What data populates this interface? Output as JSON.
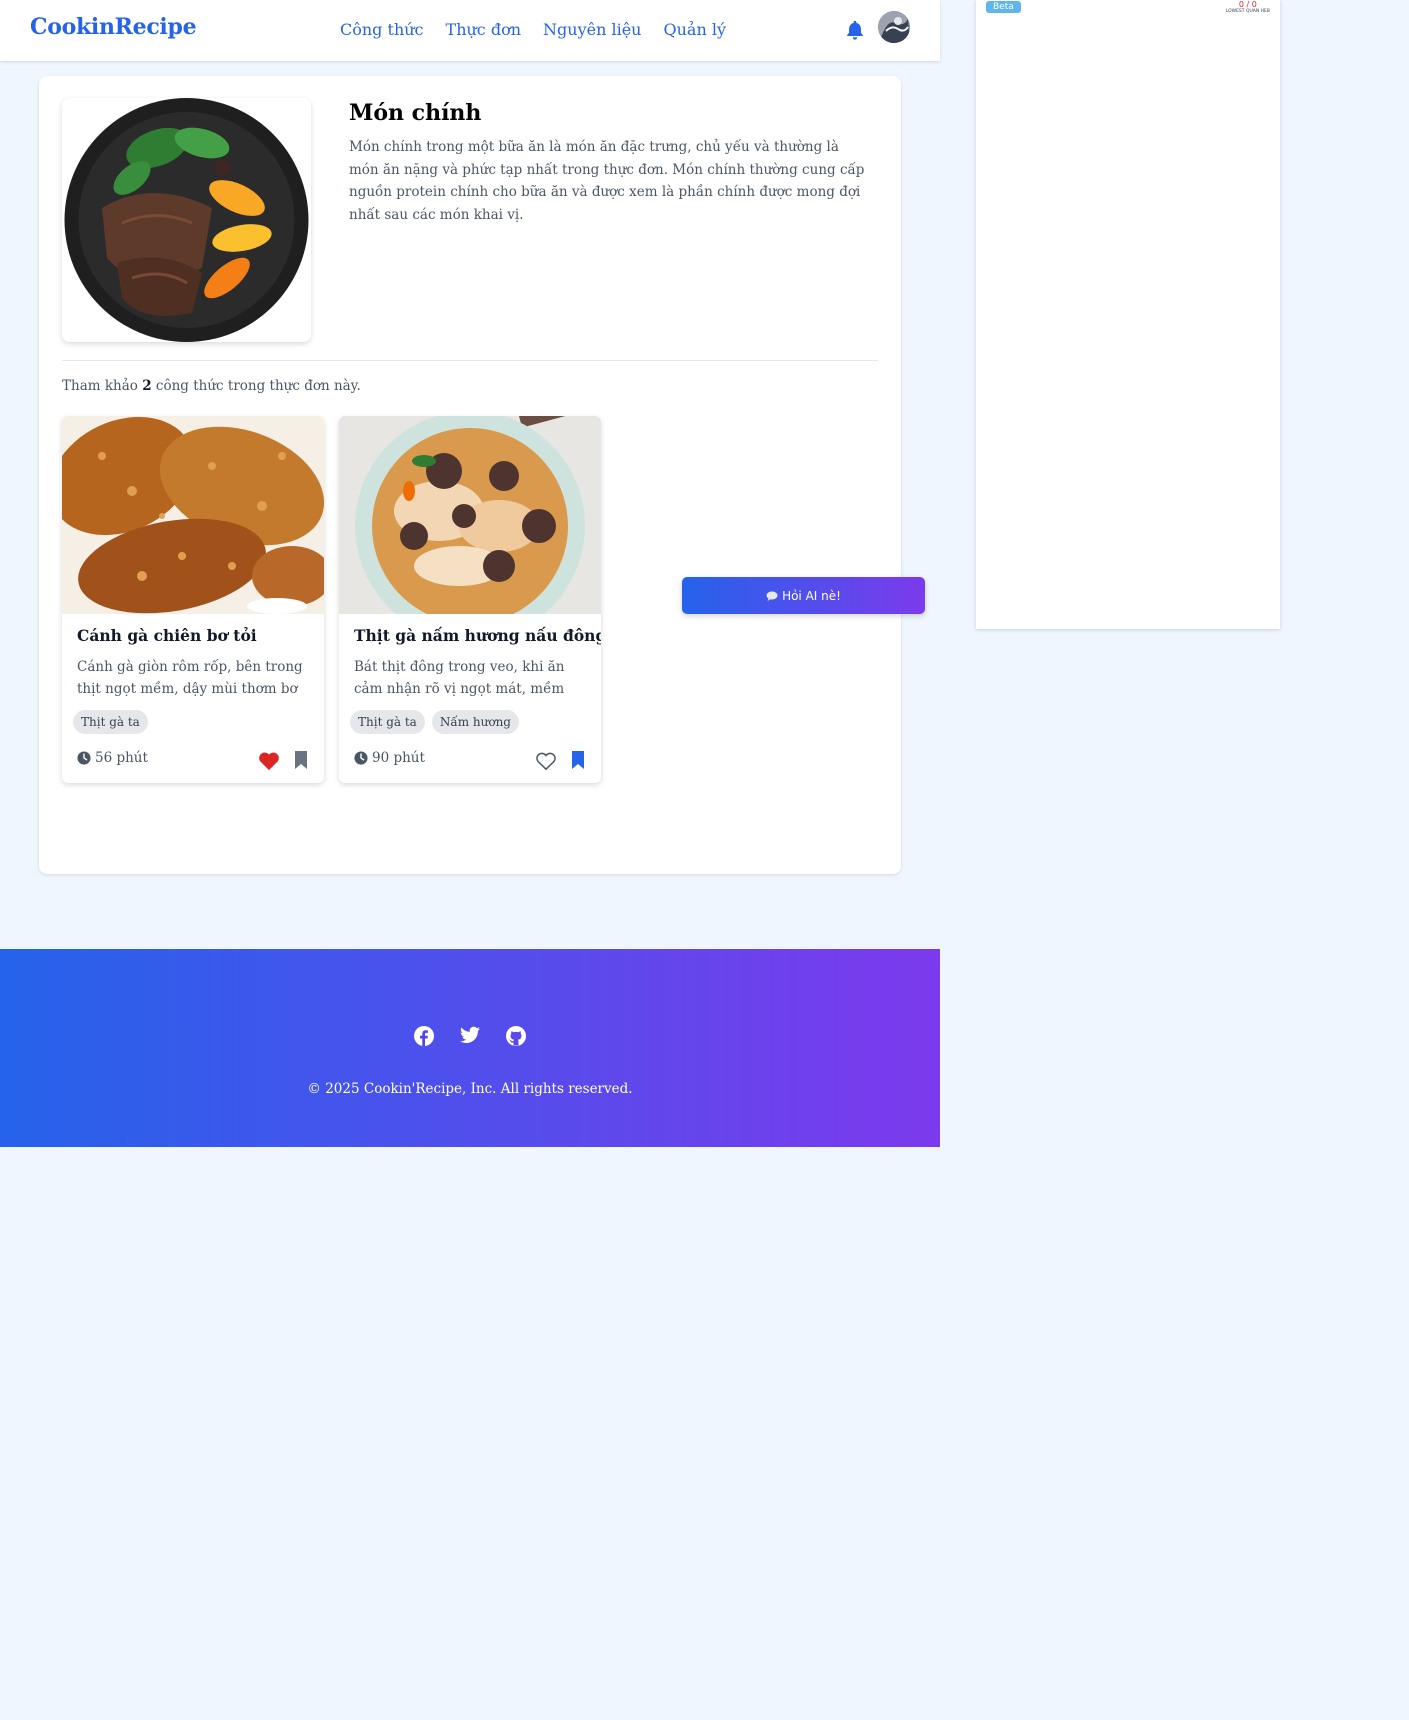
{
  "navbar": {
    "brand": "CookinRecipe",
    "links": [
      "Công thức",
      "Thực đơn",
      "Nguyên liệu",
      "Quản lý"
    ],
    "bell_icon": "bell-icon",
    "accent": "#2563eb"
  },
  "side_panel": {
    "badge": "Beta",
    "counter_value": "0 / 0",
    "counter_label": "LOWEST QUAN HEB"
  },
  "category": {
    "title": "Món chính",
    "description": "Món chính trong một bữa ăn là món ăn đặc trưng, chủ yếu và thường là món ăn nặng và phức tạp nhất trong thực đơn. Món chính thường cung cấp nguồn protein chính cho bữa ăn và được xem là phần chính được mong đợi nhất sau các món khai vị."
  },
  "summary": {
    "prefix": "Tham khảo",
    "count": "2",
    "suffix": "công thức trong thực đơn này."
  },
  "recipes": [
    {
      "title": "Cánh gà chiên bơ tỏi",
      "description": "Cánh gà giòn rôm rốp, bên trong thịt ngọt mềm, dậy mùi thơm bơ tỏi. Khi ăn",
      "tags": [
        "Thịt gà ta"
      ],
      "time": "56 phút",
      "liked": true,
      "bookmarked": false,
      "heart_color": "#dc2626",
      "bookmark_color": "#6b7280"
    },
    {
      "title": "Thịt gà nấm hương nấu đông",
      "description": "Bát thịt đông trong veo, khi ăn cảm nhận rõ vị ngọt mát, mềm mại, thoang",
      "tags": [
        "Thịt gà ta",
        "Nấm hương"
      ],
      "time": "90 phút",
      "liked": false,
      "bookmarked": true,
      "heart_color": "#4b5563",
      "bookmark_color": "#2563eb"
    }
  ],
  "chat": {
    "label": "Hỏi AI nè!",
    "icon": "speech-bubble-icon"
  },
  "footer": {
    "social_icons": [
      "facebook-icon",
      "twitter-icon",
      "github-icon"
    ],
    "copyright": "© 2025 Cookin'Recipe, Inc. All rights reserved."
  }
}
